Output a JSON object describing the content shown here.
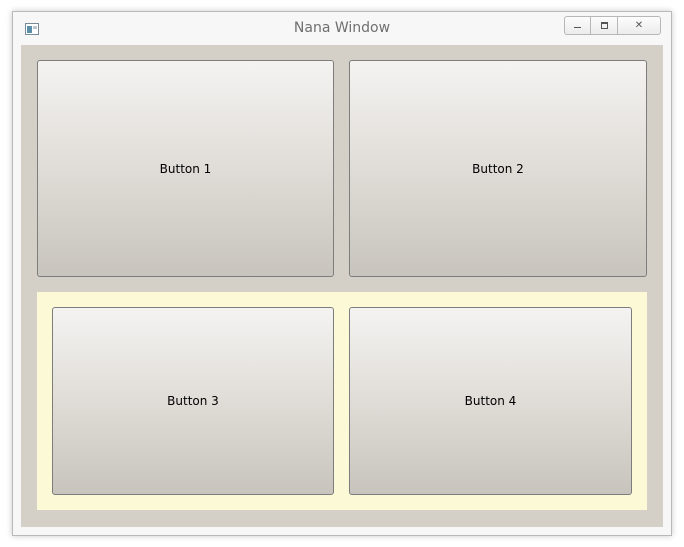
{
  "window": {
    "title": "Nana Window",
    "icon": "application-icon",
    "caption_buttons": [
      {
        "name": "minimize",
        "icon": "minimize-icon"
      },
      {
        "name": "maximize",
        "icon": "maximize-icon"
      },
      {
        "name": "close",
        "icon": "close-icon",
        "glyph": "✕"
      }
    ]
  },
  "colors": {
    "client_background": "#d4d0c8",
    "panel_background": "#fcfad6",
    "title_text": "#6f6f6f"
  },
  "buttons": {
    "top": [
      {
        "label": "Button 1"
      },
      {
        "label": "Button 2"
      }
    ],
    "panel": [
      {
        "label": "Button 3"
      },
      {
        "label": "Button 4"
      }
    ]
  }
}
